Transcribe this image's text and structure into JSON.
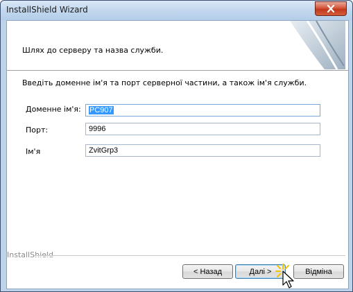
{
  "window": {
    "title": "InstallShield Wizard"
  },
  "header": {
    "text": "Шлях до серверу та назва служби."
  },
  "content": {
    "instruction": "Введіть доменне ім'я та порт серверної частини, а також ім'я служби.",
    "fields": [
      {
        "label": "Доменне ім'я:",
        "value": "PC907"
      },
      {
        "label": "Порт:",
        "value": "9996"
      },
      {
        "label": "Ім'я",
        "value": "ZvitGrp3"
      }
    ]
  },
  "footer": {
    "brand": "InstallShield",
    "back_label": "< Назад",
    "next_label": "Далі >",
    "cancel_label": "Відміна"
  },
  "icons": {
    "close": "close-icon",
    "cursor": "mouse-cursor-icon"
  },
  "colors": {
    "selection": "#3399ff",
    "close_button": "#c2381c"
  }
}
